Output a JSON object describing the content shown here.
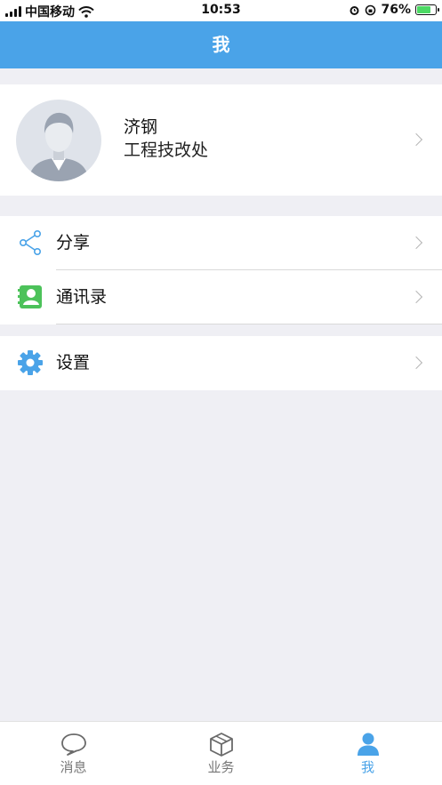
{
  "status_bar": {
    "carrier": "中国移动",
    "time": "10:53",
    "battery": "76%",
    "battery_level": 0.76
  },
  "header": {
    "title": "我"
  },
  "profile": {
    "name": "济钢",
    "department": "工程技改处"
  },
  "menu": {
    "share": {
      "label": "分享",
      "icon": "share-icon"
    },
    "contacts": {
      "label": "通讯录",
      "icon": "contacts-icon"
    },
    "settings": {
      "label": "设置",
      "icon": "gear-icon"
    }
  },
  "tabbar": {
    "messages": {
      "label": "消息",
      "icon": "chat-bubble-icon"
    },
    "business": {
      "label": "业务",
      "icon": "box-icon"
    },
    "me": {
      "label": "我",
      "icon": "person-icon"
    }
  },
  "colors": {
    "accent": "#4aa3e8",
    "contacts_green": "#4cc25a",
    "background": "#efeff4"
  }
}
